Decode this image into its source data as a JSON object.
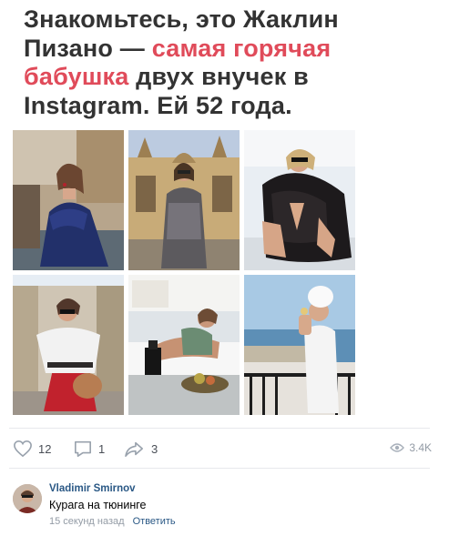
{
  "headline": {
    "line1": "Знакомьтесь, это Жаклин",
    "line2_pre": "Пизано — ",
    "line2_hl": "самая горячая",
    "line3_hl": "бабушка",
    "line3_post": " двух внучек в",
    "line4": "Instagram. Ей 52 года."
  },
  "photos": [
    {
      "scene": "venice-canal-blue-dress"
    },
    {
      "scene": "san-marco-basilica-tweed"
    },
    {
      "scene": "lace-kimono-poolside"
    },
    {
      "scene": "street-white-blouse-red-skirt"
    },
    {
      "scene": "sunlounger-champagne"
    },
    {
      "scene": "balcony-towel-turban"
    }
  ],
  "actions": {
    "likes": "12",
    "comments": "1",
    "shares": "3",
    "views": "3.4K"
  },
  "comment": {
    "author": "Vladimir Smirnov",
    "text": "Курага на тюнинге",
    "time": "15 секунд назад",
    "reply_label": "Ответить"
  },
  "colors": {
    "headline": "#333333",
    "highlight": "#e04b5a",
    "link": "#2a5885",
    "muted": "#939ba5"
  }
}
